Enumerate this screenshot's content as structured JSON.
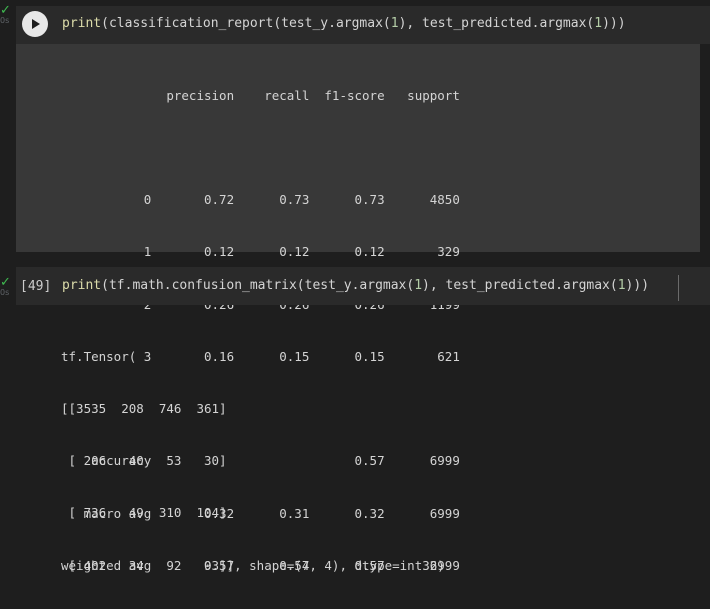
{
  "cells": [
    {
      "status": "✓",
      "time": "0s",
      "exec_count": "",
      "code": {
        "fn": "print",
        "p1": "(classification_report(test_y.argmax(",
        "n1": "1",
        "p2": "), test_predicted.argmax(",
        "n2": "1",
        "p3": ")))"
      },
      "output_lines": [
        "              precision    recall  f1-score   support",
        "",
        "           0       0.72      0.73      0.73      4850",
        "           1       0.12      0.12      0.12       329",
        "           2       0.26      0.26      0.26      1199",
        "           3       0.16      0.15      0.15       621",
        "",
        "    accuracy                           0.57      6999",
        "   macro avg       0.32      0.31      0.32      6999",
        "weighted avg       0.57      0.57      0.57      6999"
      ]
    },
    {
      "status": "✓",
      "time": "0s",
      "exec_count": "[49]",
      "code": {
        "fn": "print",
        "p1": "(tf.math.confusion_matrix(test_y.argmax(",
        "n1": "1",
        "p2": "), test_predicted.argmax(",
        "n2": "1",
        "p3": ")))"
      },
      "output_lines": [
        "tf.Tensor(",
        "[[3535  208  746  361]",
        " [ 206   40   53   30]",
        " [ 736   49  310  104]",
        " [ 402   34   92   93]], shape=(4, 4), dtype=int32)"
      ]
    }
  ],
  "colors": {
    "background": "#1e1e1e",
    "code_cell": "#2a2a2a",
    "output_panel": "#383838",
    "check": "#3fb950",
    "function": "#dcdcaa",
    "number": "#b5cea8"
  },
  "icons": {
    "run": "play-icon",
    "status": "check-icon"
  }
}
